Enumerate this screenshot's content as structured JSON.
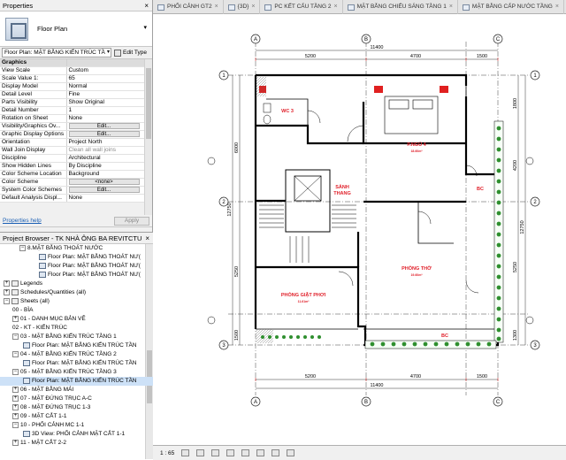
{
  "properties": {
    "title": "Properties",
    "close": "×",
    "type_name": "Floor Plan",
    "selector_value": "Floor Plan: MẶT BẰNG KIẾN TRÚC TẦ",
    "edit_type_label": "Edit Type",
    "rows": [
      {
        "k": "Graphics",
        "v": "",
        "section": true
      },
      {
        "k": "View Scale",
        "v": "Custom"
      },
      {
        "k": "Scale Value   1:",
        "v": "65"
      },
      {
        "k": "Display Model",
        "v": "Normal"
      },
      {
        "k": "Detail Level",
        "v": "Fine"
      },
      {
        "k": "Parts Visibility",
        "v": "Show Original"
      },
      {
        "k": "Detail Number",
        "v": "1"
      },
      {
        "k": "Rotation on Sheet",
        "v": "None"
      },
      {
        "k": "Visibility/Graphics Ov...",
        "v": "Edit...",
        "button": true
      },
      {
        "k": "Graphic Display Options",
        "v": "Edit...",
        "button": true
      },
      {
        "k": "Orientation",
        "v": "Project North"
      },
      {
        "k": "Wall Join Display",
        "v": "Clean all wall joins",
        "dim": true
      },
      {
        "k": "Discipline",
        "v": "Architectural"
      },
      {
        "k": "Show Hidden Lines",
        "v": "By Discipline"
      },
      {
        "k": "Color Scheme Location",
        "v": "Background"
      },
      {
        "k": "Color Scheme",
        "v": "<none>",
        "button": true
      },
      {
        "k": "System Color Schemes",
        "v": "Edit...",
        "button": true
      },
      {
        "k": "Default Analysis Displ...",
        "v": "None"
      }
    ],
    "help_link": "Properties help",
    "apply_label": "Apply"
  },
  "browser": {
    "title": "Project Browser - TK NHÀ ÔNG BA REVITCTU",
    "close": "×",
    "rows": [
      {
        "indent": 22,
        "exp": "−",
        "label": "8.MẶT BẰNG THOÁT NƯỚC",
        "icon": "none"
      },
      {
        "indent": 44,
        "label": "Floor Plan: MẶT BẰNG THOÁT NƯ(",
        "icon": "view"
      },
      {
        "indent": 44,
        "label": "Floor Plan: MẶT BẰNG THOÁT NƯ(",
        "icon": "view"
      },
      {
        "indent": 44,
        "label": "Floor Plan: MẶT BẰNG THOÁT NƯ(",
        "icon": "view"
      },
      {
        "indent": 4,
        "exp": "+",
        "label": "Legends",
        "icon": "group"
      },
      {
        "indent": 4,
        "exp": "+",
        "label": "Schedules/Quantities (all)",
        "icon": "group"
      },
      {
        "indent": 4,
        "exp": "−",
        "label": "Sheets (all)",
        "icon": "group"
      },
      {
        "indent": 14,
        "label": "00 - BÌA",
        "icon": "none"
      },
      {
        "indent": 14,
        "exp": "+",
        "label": "01 - DANH MỤC BẢN VẼ",
        "icon": "none"
      },
      {
        "indent": 14,
        "label": "02 - KT - KIẾN TRÚC",
        "icon": "none"
      },
      {
        "indent": 14,
        "exp": "−",
        "label": "03 - MẶT BẰNG KIẾN TRÚC TẦNG 1",
        "icon": "none"
      },
      {
        "indent": 26,
        "label": "Floor Plan: MẶT BẰNG KIẾN TRÚC TẦN",
        "icon": "view"
      },
      {
        "indent": 14,
        "exp": "−",
        "label": "04 - MẶT BẰNG KIẾN TRÚC TẦNG 2",
        "icon": "none"
      },
      {
        "indent": 26,
        "label": "Floor Plan: MẶT BẰNG KIẾN TRÚC TẦN",
        "icon": "view"
      },
      {
        "indent": 14,
        "exp": "−",
        "label": "05 - MẶT BẰNG KIẾN TRÚC TẦNG 3",
        "icon": "none"
      },
      {
        "indent": 26,
        "label": "Floor Plan: MẶT BẰNG KIẾN TRÚC TẦN",
        "icon": "view",
        "selected": true
      },
      {
        "indent": 14,
        "exp": "+",
        "label": "06 - MẶT BẰNG MÁI",
        "icon": "none"
      },
      {
        "indent": 14,
        "exp": "+",
        "label": "07 - MẶT ĐỨNG TRỤC A-C",
        "icon": "none"
      },
      {
        "indent": 14,
        "exp": "+",
        "label": "08 - MẶT ĐỨNG TRỤC 1-3",
        "icon": "none"
      },
      {
        "indent": 14,
        "exp": "+",
        "label": "09 - MẶT CẮT 1-1",
        "icon": "none"
      },
      {
        "indent": 14,
        "exp": "−",
        "label": "10 - PHỐI CẢNH MC 1-1",
        "icon": "none"
      },
      {
        "indent": 26,
        "label": "3D View: PHỐI CẢNH MẶT CẮT 1-1",
        "icon": "view"
      },
      {
        "indent": 14,
        "exp": "+",
        "label": "11 - MẶT CẮT 2-2",
        "icon": "none"
      }
    ]
  },
  "tabs": [
    {
      "label": "PHỐI CẢNH GT2",
      "active": false
    },
    {
      "label": "{3D}",
      "active": false
    },
    {
      "label": "PC KẾT CẤU TẦNG 2",
      "active": false
    },
    {
      "label": "MẶT BẰNG CHIẾU SÁNG TẦNG 1",
      "active": false
    },
    {
      "label": "MẶT BẰNG CẤP NƯỚC TẦNG",
      "active": false
    }
  ],
  "tab_close": "×",
  "drawing": {
    "grid_top": [
      "A",
      "B",
      "C"
    ],
    "grid_left": [
      "1",
      "2",
      "3"
    ],
    "grid_right": [
      "1",
      "2",
      "3"
    ],
    "grid_bottom": [
      "A",
      "B",
      "C"
    ],
    "dims_top_total": "11400",
    "dims_top": [
      "5200",
      "4700",
      "1500"
    ],
    "dims_bottom_total": "11400",
    "dims_bottom": [
      "5200",
      "4700",
      "1500"
    ],
    "dims_left": [
      "6000",
      "5250",
      "1500"
    ],
    "dims_left_total": "12750",
    "dims_right": [
      "1800",
      "4200",
      "5250",
      "1300"
    ],
    "dims_right_total": "12750",
    "rooms": [
      {
        "name": "WC 3",
        "area": ""
      },
      {
        "name": "P.NGỦ 4",
        "area": "18.60m²"
      },
      {
        "name": "SẢNH",
        "area": ""
      },
      {
        "name": "THANG",
        "area": ""
      },
      {
        "name": "BC",
        "area": ""
      },
      {
        "name": "PHÒNG THỜ",
        "area": "19.60m²"
      },
      {
        "name": "PHÒNG GIẶT PHƠI",
        "area": "11.61m²"
      },
      {
        "name": "BC",
        "area": ""
      }
    ]
  },
  "status": {
    "scale": "1 : 65"
  },
  "colors": {
    "accent_red": "#e0202a",
    "plant_green": "#2f8f2f",
    "panel_bg": "#f0f0f0"
  }
}
